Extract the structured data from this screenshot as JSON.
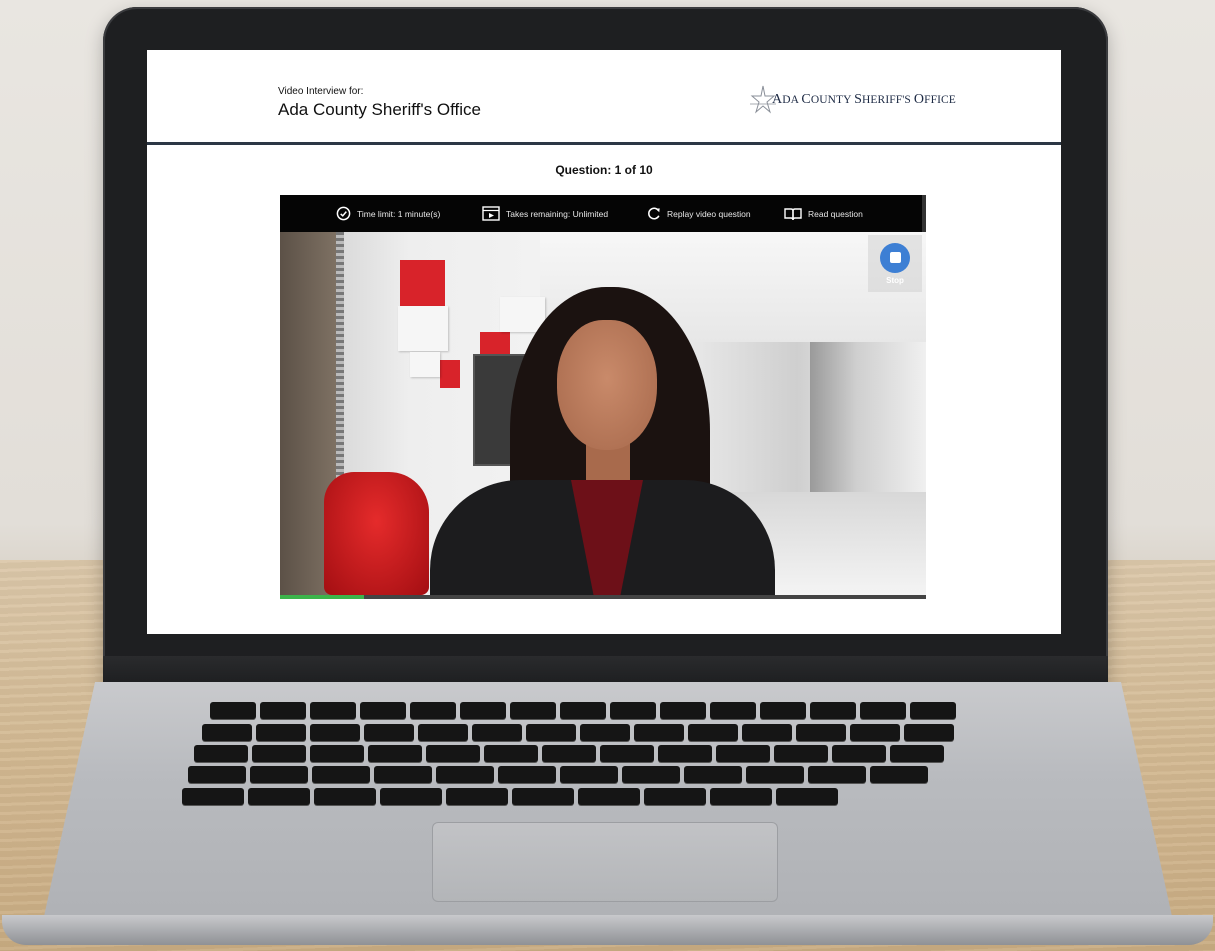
{
  "header": {
    "subtitle": "Video Interview for:",
    "title": "Ada County Sheriff's Office",
    "logo_text_first": "A",
    "logo_text_rest1": "DA ",
    "logo_text_c": "C",
    "logo_text_rest2": "OUNTY ",
    "logo_text_s": "S",
    "logo_text_rest3": "HERIFF'S ",
    "logo_text_o": "O",
    "logo_text_rest4": "FFICE"
  },
  "question": {
    "counter": "Question: 1 of 10"
  },
  "toolbar": {
    "time_limit": "Time limit: 1 minute(s)",
    "takes_remaining": "Takes remaining: Unlimited",
    "replay": "Replay video question",
    "read": "Read question"
  },
  "video": {
    "stop_label": "Stop",
    "progress_fraction": 0.13,
    "progress_color": "#3cb44b",
    "stop_color": "#3d7fd4"
  },
  "icons": [
    "clock-icon",
    "takes-icon",
    "replay-icon",
    "book-icon",
    "stop-icon",
    "sheriff-star-icon"
  ]
}
